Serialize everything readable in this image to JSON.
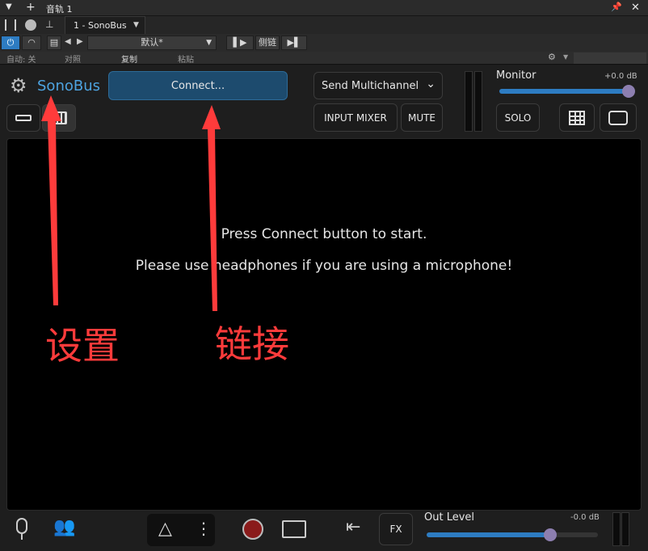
{
  "host": {
    "track_title": "音轨 1",
    "plugin_tab": "1 - SonoBus",
    "preset": "默认*",
    "sidechain_label": "侧链",
    "auto_label": "自动: 关",
    "compare_label": "对照",
    "copy_label": "复制",
    "paste_label": "粘贴"
  },
  "sonobus": {
    "app_name": "SonoBus",
    "connect_label": "Connect...",
    "send_mode": "Send Multichannel",
    "input_mixer_label": "INPUT MIXER",
    "mute_label": "MUTE",
    "solo_label": "SOLO",
    "monitor_label": "Monitor",
    "monitor_value": "+0.0 dB",
    "monitor_level": 1.0,
    "message_start": "Press Connect button to start.",
    "message_headphones": "Please use headphones if you are using a microphone!",
    "fx_label": "FX",
    "out_level_label": "Out Level",
    "out_level_value": "-0.0 dB",
    "out_level": 0.72
  },
  "annotations": {
    "settings": "设置",
    "connect": "链接",
    "color": "#ff3b3b"
  },
  "colors": {
    "accent": "#2d7cc2",
    "connect_bg": "#1d4b6e",
    "app_name": "#4da3e0"
  }
}
